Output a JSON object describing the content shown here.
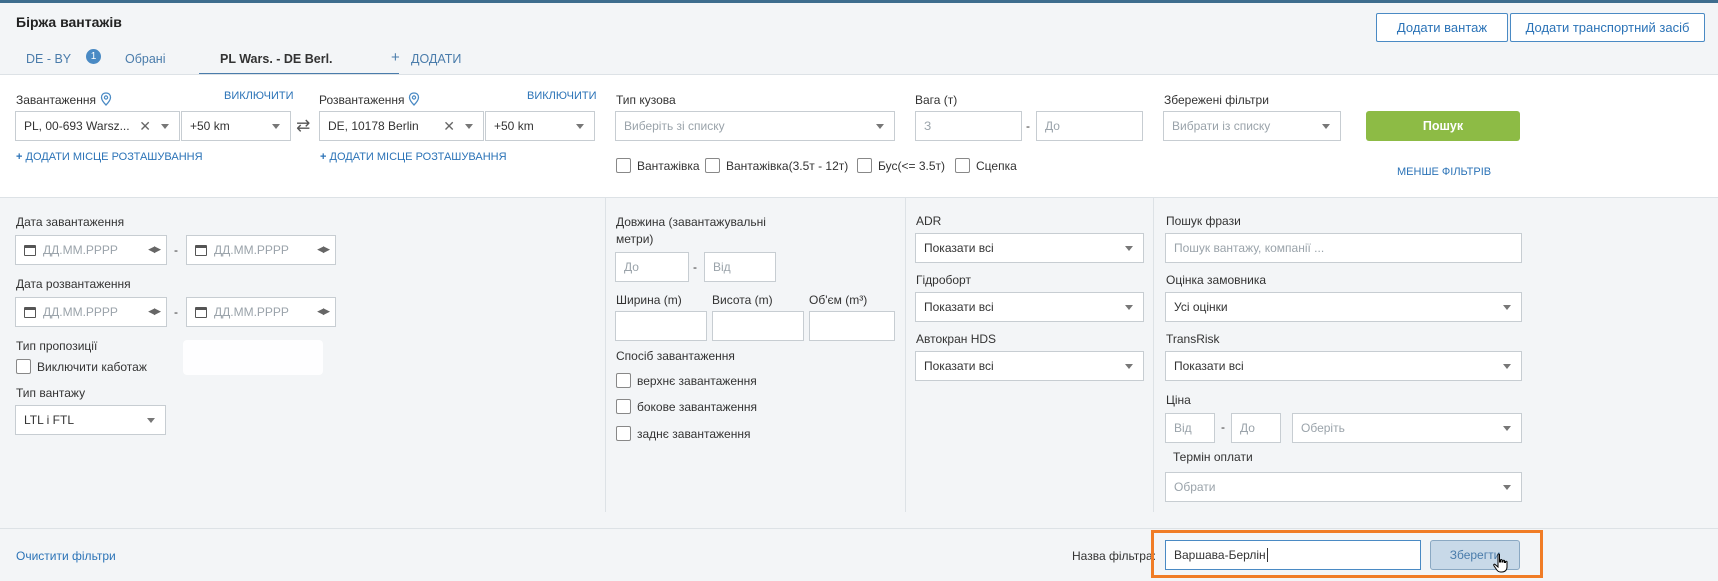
{
  "header": {
    "title": "Біржа вантажів",
    "add_cargo": "Додати вантаж",
    "add_vehicle": "Додати транспортний засіб"
  },
  "tabs": [
    {
      "label": "DE - BY"
    },
    {
      "label": "Обрані",
      "badge": "1"
    },
    {
      "label": "PL Wars. - DE Berl."
    },
    {
      "label": "ДОДАТИ"
    }
  ],
  "loading": {
    "label": "Завантаження",
    "exclude": "ВИКЛЮЧИТИ",
    "value": "PL, 00-693 Warsz...",
    "radius": "+50 km",
    "add_location": "ДОДАТИ МІСЦЕ РОЗТАШУВАННЯ"
  },
  "unloading": {
    "label": "Розвантаження",
    "exclude": "ВИКЛЮЧИТИ",
    "value": "DE, 10178 Berlin",
    "radius": "+50 km",
    "add_location": "ДОДАТИ МІСЦЕ РОЗТАШУВАННЯ"
  },
  "body_type": {
    "label": "Тип кузова",
    "placeholder": "Виберіть зі списку",
    "options": [
      "Вантажівка",
      "Вантажівка(3.5т - 12т)",
      "Бус(<= 3.5т)",
      "Сцепка"
    ]
  },
  "weight": {
    "label": "Вага (т)",
    "from_placeholder": "З",
    "to_placeholder": "До"
  },
  "saved_filters": {
    "label": "Збережені фільтри",
    "placeholder": "Вибрати із списку"
  },
  "search_button": "Пошук",
  "fewer_filters": "МЕНШЕ ФІЛЬТРІВ",
  "dates": {
    "loading_label": "Дата завантаження",
    "unloading_label": "Дата розвантаження",
    "placeholder": "ДД.ММ.РРРР"
  },
  "offer_type": {
    "label": "Тип пропозиції",
    "exclude_cabotage": "Виключити каботаж"
  },
  "cargo_type": {
    "label": "Тип вантажу",
    "value": "LTL і FTL"
  },
  "length": {
    "label": "Довжина (завантажувальні метри)",
    "from": "До",
    "to": "Від"
  },
  "dimensions": {
    "width": "Ширина (m)",
    "height": "Висота (m)",
    "volume": "Об'єм (m³)"
  },
  "loading_method": {
    "label": "Спосіб завантаження",
    "options": [
      "верхнє завантаження",
      "бокове завантаження",
      "заднє завантаження"
    ]
  },
  "adr": {
    "label": "ADR",
    "value": "Показати всі"
  },
  "tail_lift": {
    "label": "Гідроборт",
    "value": "Показати всі"
  },
  "crane": {
    "label": "Автокран HDS",
    "value": "Показати всі"
  },
  "phrase": {
    "label": "Пошук фрази",
    "placeholder": "Пошук вантажу, компанії ..."
  },
  "rating": {
    "label": "Оцінка замовника",
    "value": "Усі оцінки"
  },
  "transrisk": {
    "label": "TransRisk",
    "value": "Показати всі"
  },
  "price": {
    "label": "Ціна",
    "from": "Від",
    "to": "До",
    "currency": "Оберіть"
  },
  "payment": {
    "label": "Термін оплати",
    "value": "Обрати"
  },
  "footer": {
    "clear": "Очистити фільтри",
    "filter_name_label": "Назва фільтра:",
    "filter_name_value": "Варшава-Берлін",
    "save": "Зберегти"
  },
  "colors": {
    "accent": "#4a8ac4",
    "search_button": "#8dbb45",
    "highlight": "#f07c26"
  }
}
